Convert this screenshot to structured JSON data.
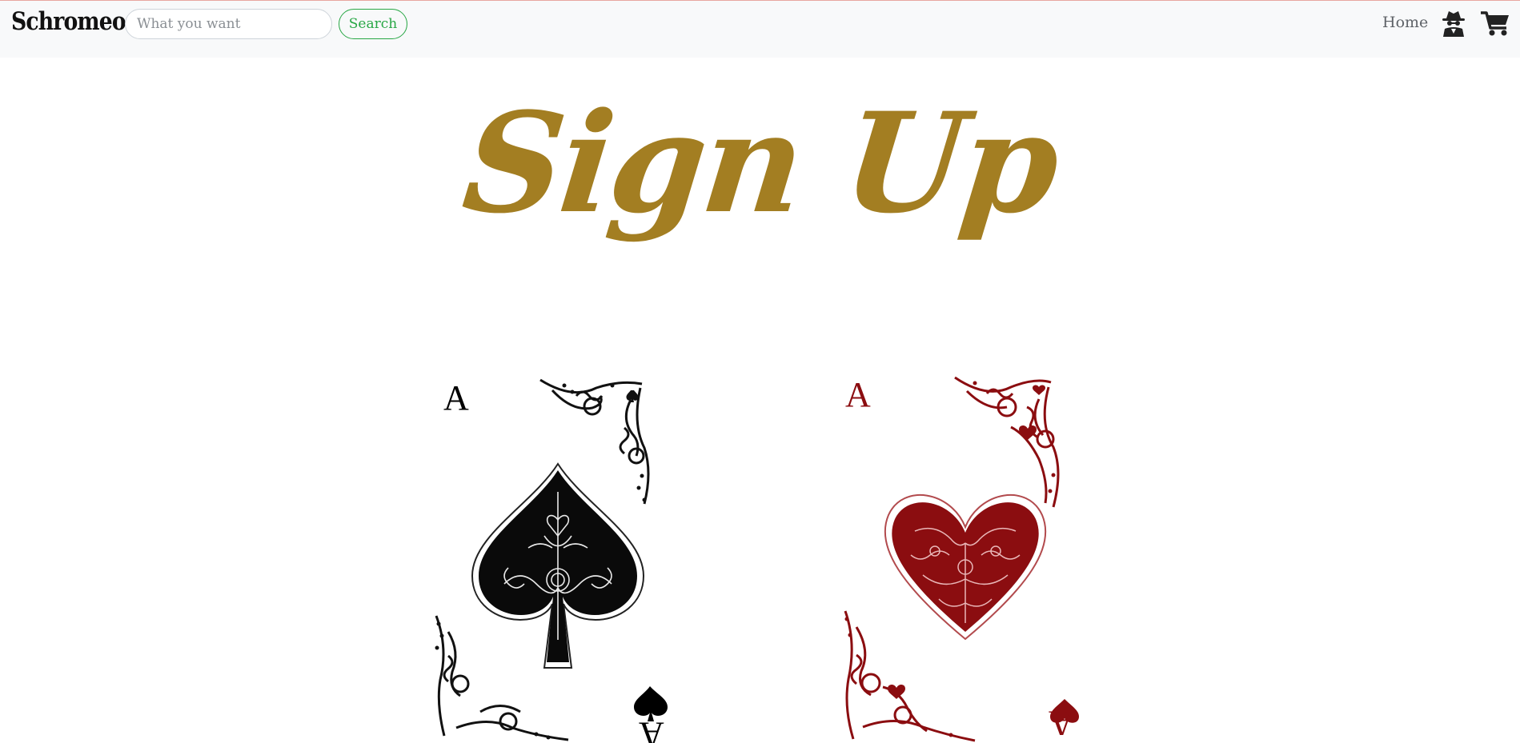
{
  "navbar": {
    "brand": "Schromeo",
    "search": {
      "placeholder": "What you want",
      "value": ""
    },
    "search_button": "Search",
    "links": [
      {
        "label": "Home"
      }
    ],
    "icons": [
      "spy-icon",
      "shopping-cart-icon"
    ]
  },
  "page": {
    "title": "Sign Up",
    "title_color": "#a37e22"
  },
  "cards": [
    {
      "rank": "A",
      "suit": "spade",
      "color": "#000000"
    },
    {
      "rank": "A",
      "suit": "heart",
      "color": "#8b0d10"
    }
  ]
}
